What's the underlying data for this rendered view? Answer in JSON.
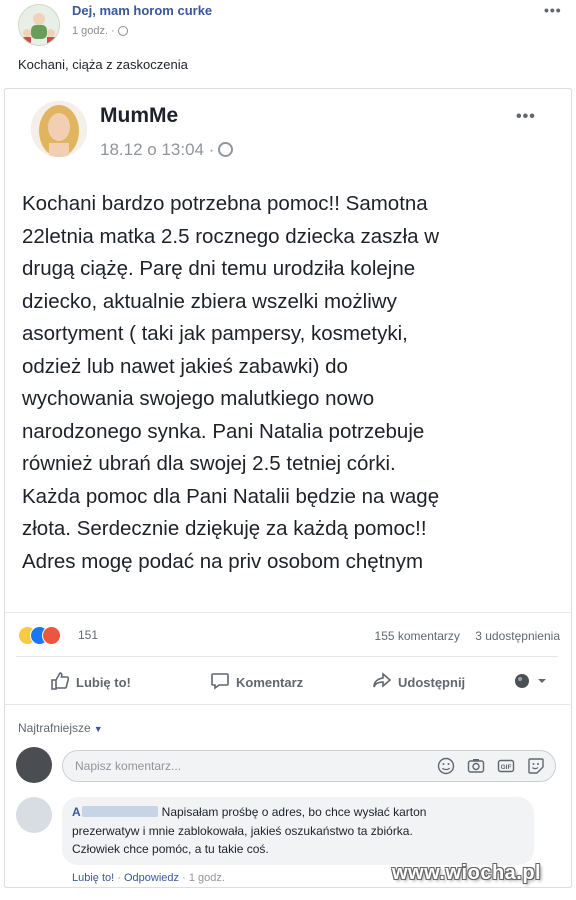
{
  "group": {
    "name": "Dej, mam horom curke",
    "time": "1 godz. ·",
    "caption": "Kochani, ciąża z zaskoczenia"
  },
  "post": {
    "author": "MumMe",
    "time": "18.12 o 13:04 ·",
    "lines": [
      "Kochani bardzo potrzebna pomoc!! Samotna",
      "22letnia matka 2.5 rocznego dziecka zaszła w",
      "drugą ciążę. Parę dni temu urodziła kolejne",
      "dziecko, aktualnie zbiera wszelki możliwy",
      "asortyment ( taki jak pampersy, kosmetyki,",
      "odzież lub nawet jakieś zabawki) do",
      "wychowania swojego malutkiego  nowo",
      "narodzonego synka. Pani Natalia potrzebuje",
      "również ubrań dla swojej 2.5 tetniej córki.",
      "Każda pomoc dla Pani Natalii będzie na wagę",
      "złota. Serdecznie dziękuję za każdą pomoc!!",
      "Adres mogę podać na priv osobom chętnym"
    ]
  },
  "stats": {
    "reactions_count": "151",
    "comments": "155 komentarzy",
    "shares": "3 udostępnienia"
  },
  "actions": {
    "like": "Lubię to!",
    "comment": "Komentarz",
    "share": "Udostępnij"
  },
  "comments_section": {
    "sort_label": "Najtrafniejsze",
    "placeholder": "Napisz komentarz...",
    "comment": {
      "name_initial": "A",
      "text_lines": [
        "Napisałam prośbę o adres, bo chce wysłać karton",
        "prezerwatyw i mnie zablokowała, jakieś oszukaństwo ta zbiórka.",
        "Człowiek chce pomóc, a tu takie coś."
      ],
      "like": "Lubię to!",
      "reply": "Odpowiedz",
      "time": "1 godz."
    }
  },
  "watermark": "www.wiocha.pl",
  "icons": [
    "globe-icon",
    "more-icon",
    "like-icon",
    "comment-icon",
    "share-icon",
    "emoji-icon",
    "camera-icon",
    "gif-icon",
    "sticker-icon"
  ],
  "colors": {
    "link": "#385898",
    "muted": "#606770",
    "reaction_like": "#1877f2",
    "reaction_haha": "#f7c948",
    "reaction_angry": "#e9573f"
  }
}
